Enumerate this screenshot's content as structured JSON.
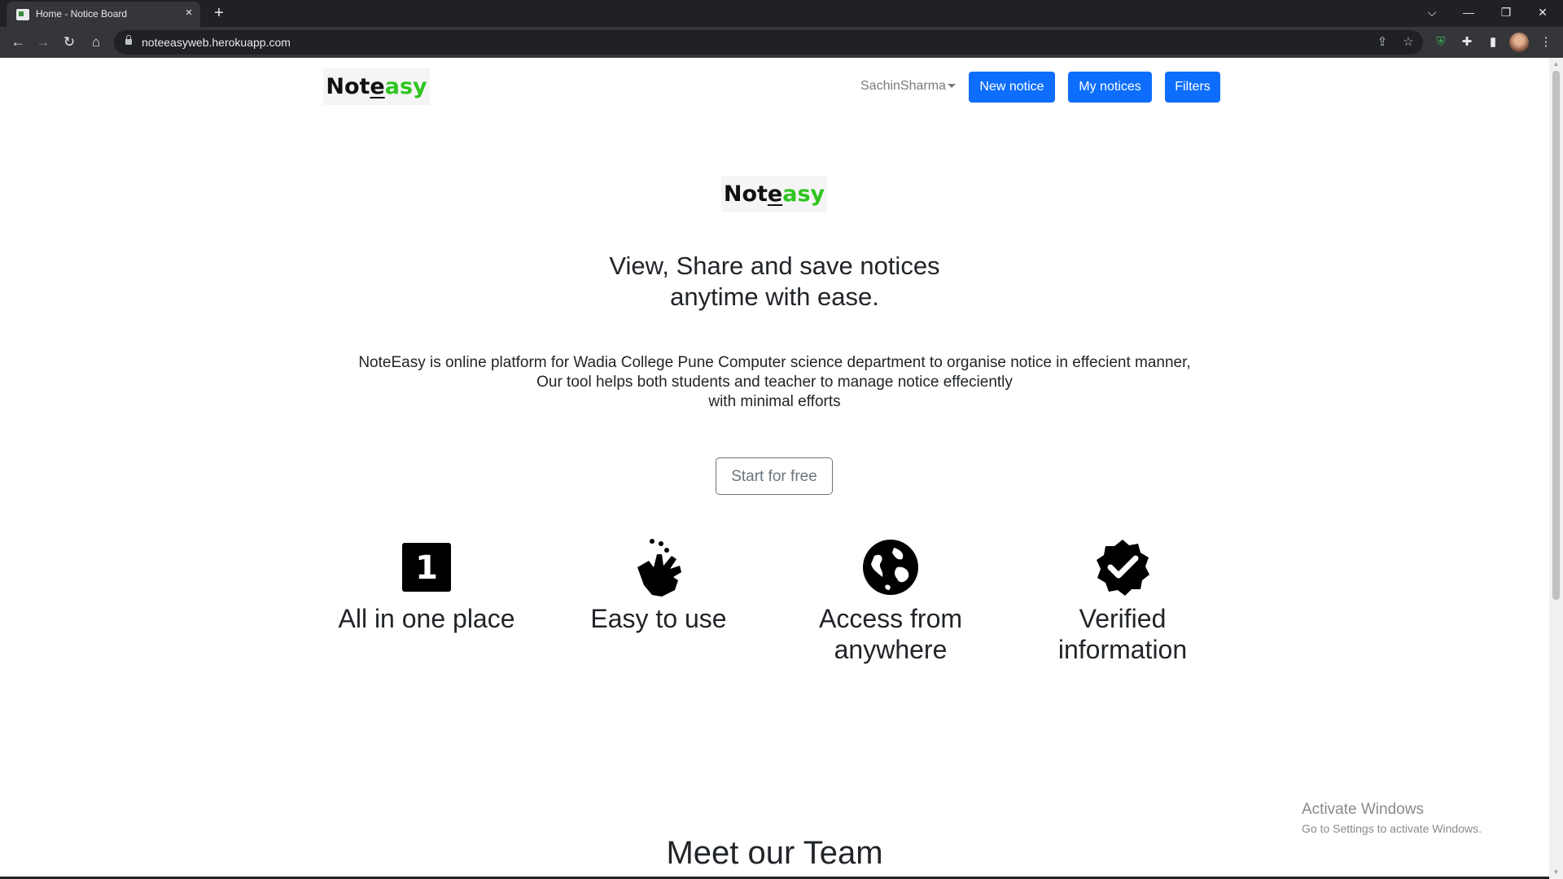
{
  "browser": {
    "tab_title": "Home - Notice Board",
    "tab_close": "×",
    "new_tab": "+",
    "url": "noteeasyweb.herokuapp.com",
    "window_controls": {
      "dropdown": "⌵",
      "minimize": "—",
      "restore": "❐",
      "close": "✕"
    },
    "nav": {
      "back": "←",
      "forward": "→",
      "reload": "↻",
      "home": "⌂"
    },
    "omnibox_icons": {
      "share": "⇪",
      "bookmark": "☆"
    },
    "extensions": {
      "shield": "⛨",
      "puzzle": "✚",
      "sidepanel": "▮",
      "menu": "⋮"
    }
  },
  "navbar": {
    "logo": {
      "note": "Not",
      "e": "e",
      "asy": "asy"
    },
    "user": "SachinSharma",
    "buttons": {
      "new_notice": "New notice",
      "my_notices": "My notices",
      "filters": "Filters"
    }
  },
  "hero": {
    "logo": {
      "note": "Not",
      "e": "e",
      "asy": "asy"
    },
    "title_line1": "View, Share and save notices",
    "title_line2": "anytime with ease.",
    "desc_line1": "NoteEasy is online platform for Wadia College Pune Computer science department to organise notice in effecient manner,",
    "desc_line2": "Our tool helps both students and teacher to manage notice effeciently",
    "desc_line3": "with minimal efforts",
    "cta": "Start for free"
  },
  "features": [
    {
      "icon": "one-square-icon",
      "digit": "1",
      "label_line1": "All in one place",
      "label_line2": ""
    },
    {
      "icon": "hand-tap-icon",
      "label_line1": "Easy to use",
      "label_line2": ""
    },
    {
      "icon": "globe-icon",
      "label_line1": "Access from",
      "label_line2": "anywhere"
    },
    {
      "icon": "verified-badge-icon",
      "label_line1": "Verified",
      "label_line2": "information"
    }
  ],
  "team": {
    "heading": "Meet our Team"
  },
  "watermark": {
    "title": "Activate Windows",
    "subtitle": "Go to Settings to activate Windows."
  },
  "colors": {
    "primary": "#0d6efd",
    "logo_green": "#2fc51f",
    "text": "#212529",
    "muted": "#6c757d"
  }
}
